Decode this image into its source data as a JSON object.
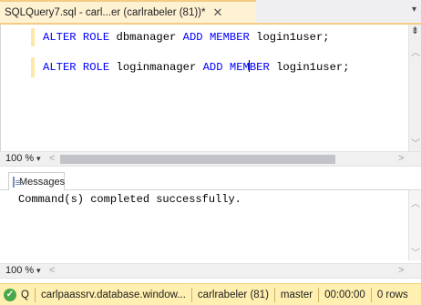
{
  "document_tab": {
    "title": "SQLQuery7.sql - carl...er (carlrabeler (81))*",
    "close_glyph": "✕",
    "dropdown_glyph": "▾"
  },
  "editor": {
    "lines": [
      {
        "kw1": "ALTER",
        "kw2": "ROLE",
        "name": "dbmanager",
        "kw3": "ADD",
        "kw4": "MEMBER",
        "user": "login1user;"
      },
      {
        "kw1": "ALTER",
        "kw2": "ROLE",
        "name": "loginmanager",
        "kw3": "ADD",
        "kw4a": "MEM",
        "kw4b": "BER",
        "user": "login1user;"
      }
    ]
  },
  "editor_bar": {
    "zoom": "100 %",
    "zoom_arrow": "▾",
    "left": "<",
    "right": ">"
  },
  "results": {
    "tab_label": "Messages",
    "message": "Command(s) completed successfully."
  },
  "results_bar": {
    "zoom": "100 %",
    "zoom_arrow": "▾",
    "left": "<",
    "right": ">"
  },
  "status": {
    "icon": "✓",
    "query_label": "Q",
    "server": "carlpaassrv.database.window...",
    "user": "carlrabeler (81)",
    "database": "master",
    "elapsed": "00:00:00",
    "rows": "0 rows"
  },
  "colors": {
    "tab_active": "#fff2d3",
    "accent": "#f5cc84",
    "status_bar": "#ffefb0",
    "keyword": "#0000ff",
    "success": "#4aa84a"
  }
}
